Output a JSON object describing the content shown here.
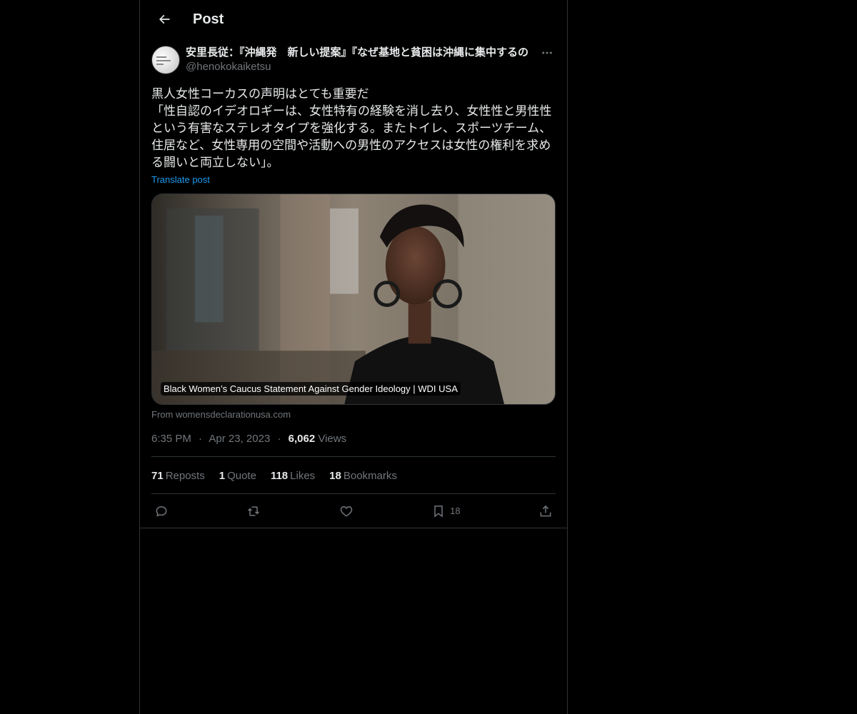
{
  "header": {
    "title": "Post"
  },
  "post": {
    "author": {
      "display_name": "安里長従：『沖縄発　新しい提案』『なぜ基地と貧困は沖縄に集中するの",
      "handle": "@henokokaiketsu"
    },
    "text": "黒人女性コーカスの声明はとても重要だ\n「性自認のイデオロギーは、女性特有の経験を消し去り、女性性と男性性\nという有害なステレオタイプを強化する。またトイレ、スポーツチーム、\n住居など、女性専用の空間や活動への男性のアクセスは女性の権利を求め\nる闘いと両立しない」。",
    "translate_label": "Translate post",
    "card": {
      "caption": "Black Women’s Caucus Statement Against Gender Ideology | WDI USA",
      "source": "From womensdeclarationusa.com"
    },
    "meta": {
      "time": "6:35 PM",
      "date": "Apr 23, 2023",
      "views_count": "6,062",
      "views_label": "Views",
      "separator": "·"
    },
    "stats": {
      "reposts_count": "71",
      "reposts_label": "Reposts",
      "quotes_count": "1",
      "quotes_label": "Quote",
      "likes_count": "118",
      "likes_label": "Likes",
      "bookmarks_count": "18",
      "bookmarks_label": "Bookmarks"
    },
    "actions": {
      "bookmark_count": "18"
    }
  },
  "colors": {
    "background": "#000000",
    "text_primary": "#e7e9ea",
    "text_secondary": "#71767b",
    "link": "#1d9bf0",
    "border": "#2f3336"
  },
  "icons": {
    "back": "arrow-left-icon",
    "more": "more-horizontal-icon",
    "reply": "reply-icon",
    "repost": "repost-icon",
    "like": "heart-icon",
    "bookmark": "bookmark-icon",
    "share": "share-icon"
  }
}
